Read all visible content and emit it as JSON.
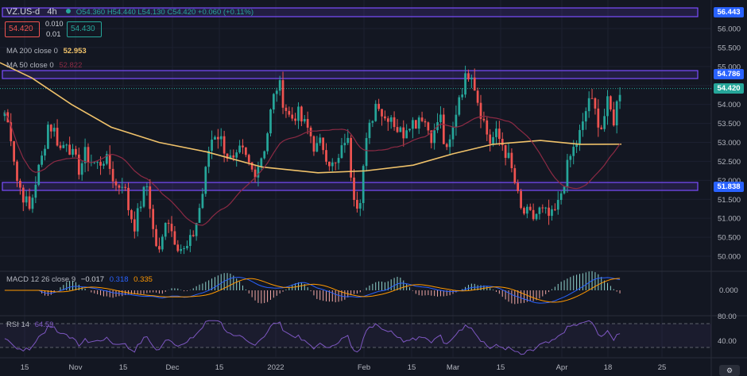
{
  "header": {
    "symbol": "VZ.US-d",
    "timeframe": "4h",
    "ohlc": "O54.360 H54.440 L54.130 C54.420 +0.060 (+0.11%)",
    "sell_price": "54.420",
    "spread_top": "0.010",
    "spread_bottom": "0.01",
    "buy_price": "54.430"
  },
  "indicators": {
    "ma200_label": "MA 200 close 0",
    "ma200_value": "52.953",
    "ma50_label": "MA 50 close 0",
    "ma50_value": "52.822",
    "macd_label": "MACD 12 26 close 9",
    "macd_value": "−0.017",
    "macd_signal": "0.318",
    "macd_hist": "0.335",
    "rsi_label": "RSI 14",
    "rsi_value": "64.59"
  },
  "price_tags": {
    "zone_top": "56.443",
    "zone_mid": "54.786",
    "current": "54.420",
    "zone_low": "51.838"
  },
  "colors": {
    "background": "#131722",
    "up": "#26a69a",
    "down": "#ef5350",
    "ma200": "#f0c26a",
    "ma50": "#8c2a44",
    "zone": "#7b4dff",
    "macd": "#2962ff",
    "signal": "#ff9800",
    "rsi": "#7e57c2"
  },
  "chart_data": {
    "type": "candlestick",
    "symbol": "VZ.US-d",
    "timeframe": "4h",
    "y_axis": {
      "ticks": [
        "56.000",
        "55.500",
        "55.000",
        "54.500",
        "54.000",
        "53.500",
        "53.000",
        "52.500",
        "52.000",
        "51.500",
        "51.000",
        "50.500",
        "50.000"
      ],
      "range": [
        49.7,
        56.6
      ]
    },
    "x_axis": {
      "ticks": [
        "15",
        "Nov",
        "15",
        "Dec",
        "15",
        "2022",
        "Feb",
        "15",
        "Mar",
        "15",
        "Apr",
        "18",
        "25"
      ]
    },
    "zones": [
      56.443,
      54.786,
      51.838
    ],
    "ma200_last": 52.953,
    "ma50_last": 52.822,
    "close_last": 54.42,
    "macd_axis_ticks": [
      "0.000"
    ],
    "rsi_axis_ticks": [
      "80.00",
      "40.00"
    ],
    "rsi_last": 64.59,
    "close_path": [
      53.8,
      53.2,
      52.0,
      51.6,
      51.2,
      52.0,
      52.6,
      53.5,
      53.3,
      52.8,
      53.1,
      52.6,
      52.3,
      52.7,
      52.5,
      52.4,
      52.6,
      52.3,
      51.8,
      52.0,
      51.2,
      50.8,
      51.5,
      51.9,
      50.5,
      50.0,
      51.2,
      50.6,
      50.3,
      50.1,
      50.4,
      51.0,
      51.8,
      53.0,
      53.3,
      53.0,
      52.6,
      52.4,
      52.8,
      52.5,
      52.2,
      52.5,
      53.0,
      54.0,
      54.6,
      54.0,
      53.6,
      53.8,
      53.5,
      53.3,
      52.8,
      53.0,
      52.6,
      52.3,
      52.6,
      53.3,
      51.8,
      51.3,
      52.8,
      53.6,
      54.2,
      53.6,
      53.8,
      53.4,
      53.2,
      53.6,
      53.5,
      53.8,
      53.4,
      53.1,
      53.8,
      52.6,
      53.2,
      54.2,
      54.6,
      55.0,
      54.2,
      53.6,
      53.0,
      53.2,
      53.0,
      52.6,
      52.0,
      51.2,
      51.1,
      51.0,
      51.2,
      51.1,
      51.0,
      51.3,
      52.0,
      52.6,
      53.0,
      53.4,
      54.2,
      53.8,
      53.4,
      54.0,
      53.6,
      54.4
    ]
  }
}
